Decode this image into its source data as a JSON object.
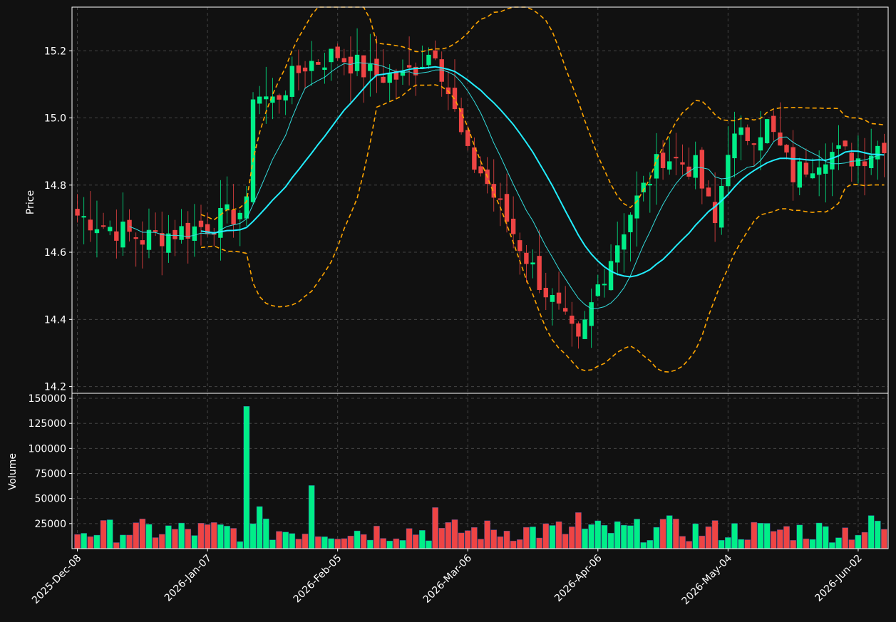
{
  "colors": {
    "background": "#111111",
    "up": "#00ee88",
    "down": "#ee4444",
    "ma_fast": "#33dddd",
    "ma_slow": "#22eeff",
    "bands": "#ffa500",
    "grid": "#444444",
    "text": "#ffffff"
  },
  "chart_data": {
    "type": "candlestick",
    "panels": [
      "price",
      "volume"
    ],
    "price_panel": {
      "ylabel": "Price",
      "ylim": [
        14.18,
        15.33
      ],
      "yticks": [
        "14.2",
        "14.4",
        "14.6",
        "14.8",
        "15.0",
        "15.2"
      ],
      "grid": true
    },
    "volume_panel": {
      "ylabel": "Volume",
      "ylim": [
        0,
        155000
      ],
      "yticks": [
        "25000",
        "50000",
        "75000",
        "100000",
        "125000",
        "150000"
      ],
      "grid": true
    },
    "x_labels": [
      "2025-Dec-08",
      "2026-Jan-07",
      "2026-Feb-05",
      "2026-Mar-06",
      "2026-Apr-06",
      "2026-May-04",
      "2026-Jun-02"
    ],
    "x_label_index": [
      0,
      20,
      40,
      60,
      80,
      100,
      120
    ],
    "num_bars": 125,
    "ohlc_keypoints": {
      "comment": "closing price trajectory anchors (bar index, close)",
      "points": [
        [
          0,
          14.71
        ],
        [
          10,
          14.64
        ],
        [
          20,
          14.68
        ],
        [
          26,
          14.73
        ],
        [
          27,
          15.08
        ],
        [
          30,
          15.05
        ],
        [
          35,
          15.16
        ],
        [
          40,
          15.19
        ],
        [
          45,
          15.13
        ],
        [
          50,
          15.12
        ],
        [
          55,
          15.21
        ],
        [
          60,
          14.88
        ],
        [
          62,
          14.84
        ],
        [
          70,
          14.55
        ],
        [
          77,
          14.32
        ],
        [
          80,
          14.5
        ],
        [
          85,
          14.72
        ],
        [
          90,
          14.89
        ],
        [
          95,
          14.85
        ],
        [
          98,
          14.68
        ],
        [
          100,
          14.92
        ],
        [
          106,
          14.98
        ],
        [
          110,
          14.83
        ],
        [
          115,
          14.9
        ],
        [
          120,
          14.88
        ],
        [
          124,
          14.93
        ]
      ]
    },
    "overlays": [
      {
        "name": "",
        "kind": "moving-average-fast"
      },
      {
        "name": "",
        "kind": "moving-average-slow"
      },
      {
        "name": "",
        "kind": "bollinger-upper"
      },
      {
        "name": "",
        "kind": "bollinger-lower"
      }
    ],
    "volume_spikes": [
      [
        26,
        142000
      ],
      [
        36,
        63000
      ],
      [
        55,
        41000
      ],
      [
        28,
        42000
      ],
      [
        77,
        36000
      ],
      [
        91,
        33000
      ],
      [
        122,
        33000
      ]
    ]
  }
}
